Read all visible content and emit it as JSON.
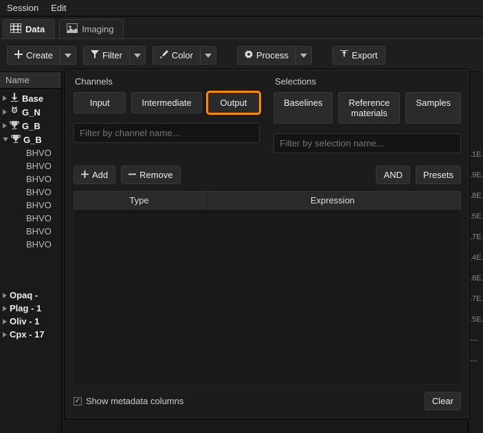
{
  "menu": {
    "session": "Session",
    "edit": "Edit"
  },
  "tabs": {
    "data": "Data",
    "imaging": "Imaging",
    "active": "data"
  },
  "toolbar": {
    "create": "Create",
    "filter": "Filter",
    "color": "Color",
    "process": "Process",
    "export": "Export"
  },
  "tree": {
    "header": "Name",
    "top": [
      {
        "label": "Base",
        "icon": "download"
      },
      {
        "label": "G_N",
        "icon": "medal"
      },
      {
        "label": "G_B",
        "icon": "trophy"
      },
      {
        "label": "G_B",
        "icon": "trophy",
        "expanded": true
      }
    ],
    "children": [
      "BHVO",
      "BHVO",
      "BHVO",
      "BHVO",
      "BHVO",
      "BHVO",
      "BHVO",
      "BHVO"
    ],
    "bottom": [
      {
        "label": "Opaq -"
      },
      {
        "label": "Plag - 1"
      },
      {
        "label": "Oliv - 1"
      },
      {
        "label": "Cpx - 17"
      }
    ]
  },
  "right_values": [
    ".1E.",
    ".9E.",
    ".8E.",
    ".5E.",
    ".7E.",
    ".4E.",
    ".8E.",
    ".7E.",
    ".5E.",
    "---",
    "---"
  ],
  "dialog": {
    "channels": {
      "title": "Channels",
      "tabs": {
        "input": "Input",
        "intermediate": "Intermediate",
        "output": "Output"
      },
      "selected": "output",
      "filter_placeholder": "Filter by channel name..."
    },
    "selections": {
      "title": "Selections",
      "tabs": {
        "baselines": "Baselines",
        "reference_materials": "Reference materials",
        "samples": "Samples"
      },
      "filter_placeholder": "Filter by selection name..."
    },
    "buttons": {
      "add": "Add",
      "remove": "Remove",
      "and": "AND",
      "presets": "Presets",
      "clear": "Clear"
    },
    "columns": {
      "type": "Type",
      "expression": "Expression"
    },
    "show_metadata": {
      "label": "Show metadata columns",
      "checked": true
    }
  }
}
